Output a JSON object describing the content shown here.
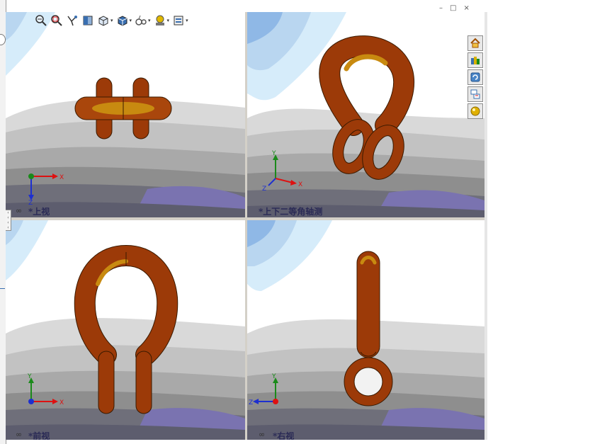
{
  "window": {
    "minimize": "–",
    "restore": "□",
    "close": "×"
  },
  "viewports": [
    {
      "id": "top",
      "label": "*上视"
    },
    {
      "id": "trimetric",
      "label": "*上下二等角轴测"
    },
    {
      "id": "front",
      "label": "*前视"
    },
    {
      "id": "right",
      "label": "*右视"
    }
  ],
  "triad": {
    "x": "X",
    "y": "Y",
    "z": "Z"
  },
  "toolbar": [
    "zoom-to-fit-icon",
    "zoom-to-area-icon",
    "previous-view-icon",
    "section-view-icon",
    "view-orientation-icon",
    "display-style-icon",
    "hide-show-items-icon",
    "edit-appearance-icon",
    "apply-scene-icon",
    "view-settings-icon"
  ],
  "taskpane": [
    "home-icon",
    "design-library-icon",
    "file-explorer-icon",
    "view-palette-icon",
    "appearances-icon"
  ],
  "colors": {
    "part": "#9c3a08",
    "part_highlight": "#c88a10",
    "sky": "#d6ecfa",
    "floor_light": "#c9c9c9",
    "floor_mid": "#8e8e8e",
    "floor_dark": "#5d5d6e",
    "floor_purple": "#7a73b0",
    "triad_x": "#d11",
    "triad_y": "#1a8a1a",
    "triad_z": "#1d2fd0"
  }
}
